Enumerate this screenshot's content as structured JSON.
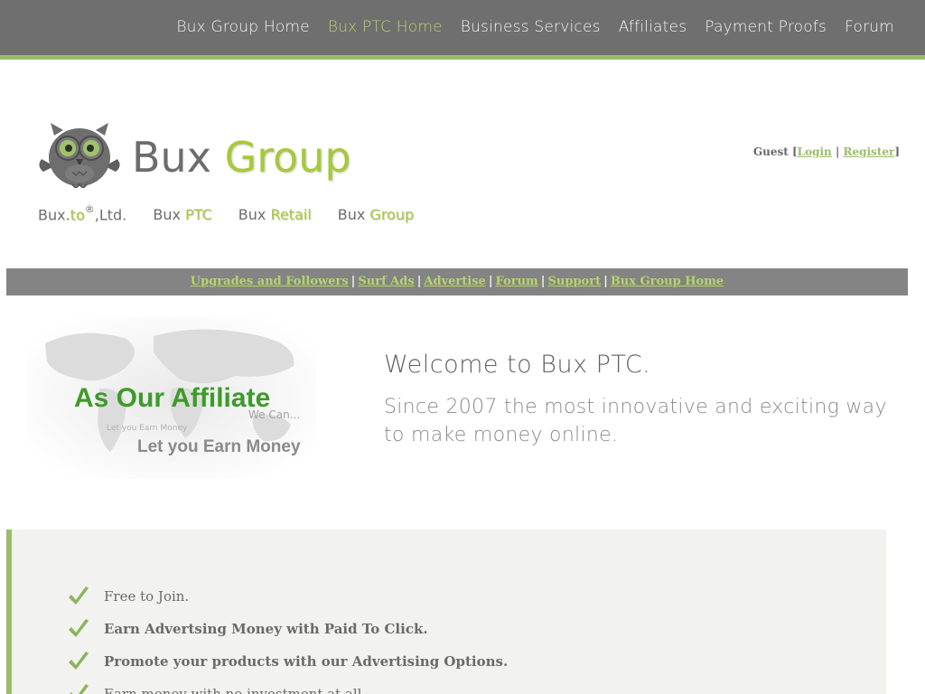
{
  "topnav": {
    "items": [
      {
        "label": "Bux Group Home"
      },
      {
        "label": "Bux PTC Home"
      },
      {
        "label": "Business Services"
      },
      {
        "label": "Affiliates"
      },
      {
        "label": "Payment Proofs"
      },
      {
        "label": "Forum"
      }
    ],
    "active_index": 1
  },
  "logo": {
    "word1": "Bux",
    "word2": "Group",
    "icon": "owl-logo-icon"
  },
  "sublinks": {
    "item1_prefix": "Bux.",
    "item1_highlight": "to",
    "item1_mark": "®",
    "item1_suffix": ",Ltd.",
    "item2_prefix": "Bux ",
    "item2_highlight": "PTC",
    "item3_prefix": "Bux ",
    "item3_highlight": "Retail",
    "item4_prefix": "Bux ",
    "item4_highlight": "Group"
  },
  "guest": {
    "label": "Guest",
    "login": "Login",
    "register": "Register"
  },
  "menubar": {
    "links": [
      "Upgrades and Followers",
      "Surf Ads",
      "Advertise",
      "Forum",
      "Support",
      "Bux Group Home"
    ],
    "separator": "|"
  },
  "banner": {
    "headline": "As Our Affiliate",
    "tagline": "Let you Earn Money",
    "small1": "We Can...",
    "small2": "Let you Earn  Money"
  },
  "welcome": {
    "title": "Welcome to Bux PTC.",
    "subtitle": "Since 2007 the most innovative and exciting way to make money online."
  },
  "features": {
    "items": [
      {
        "text": "Free to Join.",
        "bold": false
      },
      {
        "text": "Earn Advertsing Money with Paid To Click.",
        "bold": true
      },
      {
        "text": "Promote your products with our Advertising Options.",
        "bold": true
      },
      {
        "text": "Earn money with no investment at all.",
        "bold": false
      }
    ]
  },
  "colors": {
    "accent_green": "#9cbb6a",
    "brand_green": "#a5c93a",
    "nav_gray": "#6f6f6f"
  }
}
